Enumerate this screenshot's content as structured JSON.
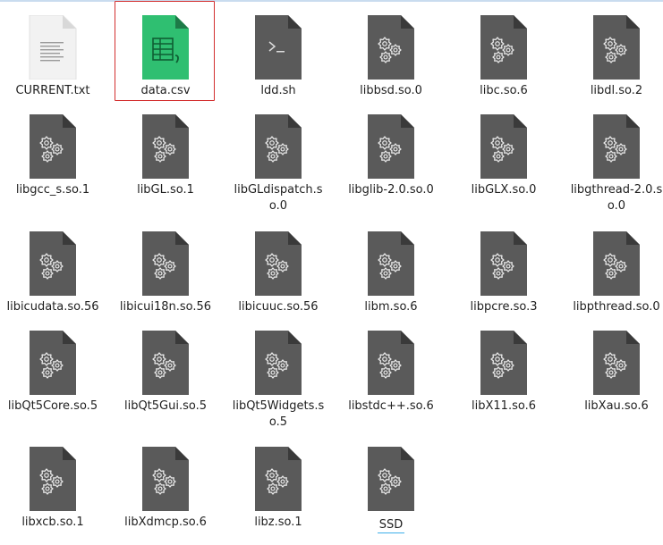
{
  "files": [
    {
      "name": "CURRENT.txt",
      "type": "text",
      "selected": false
    },
    {
      "name": "data.csv",
      "type": "spreadsheet",
      "selected": true
    },
    {
      "name": "ldd.sh",
      "type": "script",
      "selected": false
    },
    {
      "name": "libbsd.so.0",
      "type": "library",
      "selected": false
    },
    {
      "name": "libc.so.6",
      "type": "library",
      "selected": false
    },
    {
      "name": "libdl.so.2",
      "type": "library",
      "selected": false
    },
    {
      "name": "libgcc_s.so.1",
      "type": "library",
      "selected": false
    },
    {
      "name": "libGL.so.1",
      "type": "library",
      "selected": false
    },
    {
      "name": "libGLdispatch.so.0",
      "type": "library",
      "selected": false
    },
    {
      "name": "libglib-2.0.so.0",
      "type": "library",
      "selected": false
    },
    {
      "name": "libGLX.so.0",
      "type": "library",
      "selected": false
    },
    {
      "name": "libgthread-2.0.so.0",
      "type": "library",
      "selected": false
    },
    {
      "name": "libicudata.so.56",
      "type": "library",
      "selected": false
    },
    {
      "name": "libicui18n.so.56",
      "type": "library",
      "selected": false
    },
    {
      "name": "libicuuc.so.56",
      "type": "library",
      "selected": false
    },
    {
      "name": "libm.so.6",
      "type": "library",
      "selected": false
    },
    {
      "name": "libpcre.so.3",
      "type": "library",
      "selected": false
    },
    {
      "name": "libpthread.so.0",
      "type": "library",
      "selected": false
    },
    {
      "name": "libQt5Core.so.5",
      "type": "library",
      "selected": false
    },
    {
      "name": "libQt5Gui.so.5",
      "type": "library",
      "selected": false
    },
    {
      "name": "libQt5Widgets.so.5",
      "type": "library",
      "selected": false
    },
    {
      "name": "libstdc++.so.6",
      "type": "library",
      "selected": false
    },
    {
      "name": "libX11.so.6",
      "type": "library",
      "selected": false
    },
    {
      "name": "libXau.so.6",
      "type": "library",
      "selected": false
    },
    {
      "name": "libxcb.so.1",
      "type": "library",
      "selected": false
    },
    {
      "name": "libXdmcp.so.6",
      "type": "library",
      "selected": false
    },
    {
      "name": "libz.so.1",
      "type": "library",
      "selected": false
    },
    {
      "name": "SSD",
      "type": "library",
      "selected": false,
      "hovered": true
    }
  ],
  "colors": {
    "selection_border": "#d32f2f",
    "hover_underline": "#3daee9",
    "library_icon": "#555555",
    "spreadsheet_icon": "#2fbf71",
    "text_icon": "#f0f0f0"
  },
  "icons": {
    "text": "text-file-icon",
    "spreadsheet": "spreadsheet-file-icon",
    "script": "shell-script-icon",
    "library": "shared-library-icon"
  }
}
